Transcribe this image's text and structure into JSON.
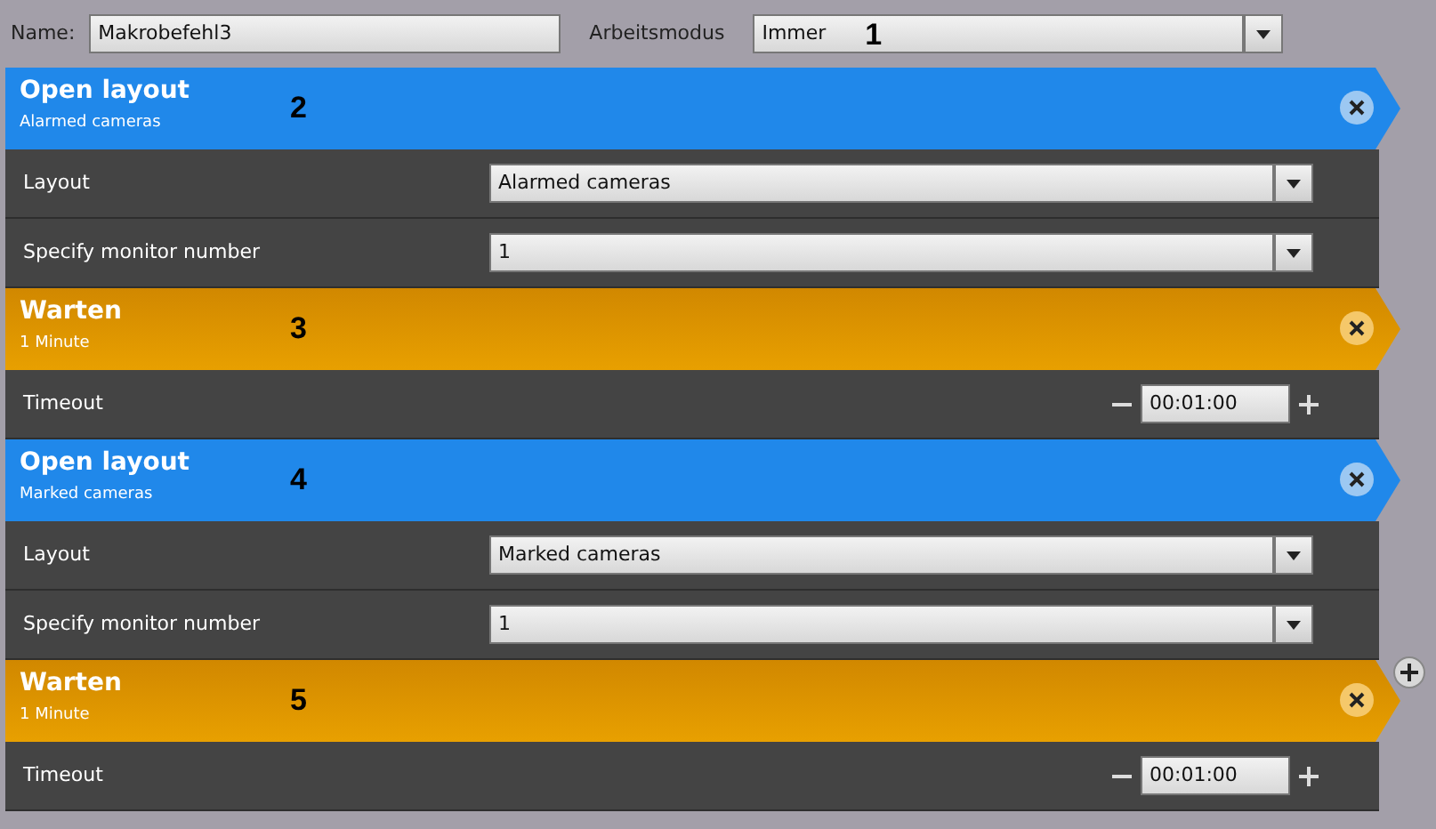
{
  "top_bar": {
    "name_label": "Name:",
    "name_value": "Makrobefehl3",
    "mode_label": "Arbeitsmodus",
    "mode_value": "Immer",
    "marker": "1"
  },
  "steps": [
    {
      "kind": "open_layout",
      "title": "Open layout",
      "subtitle": "Alarmed cameras",
      "marker": "2",
      "rows": [
        {
          "kind": "select",
          "label": "Layout",
          "value": "Alarmed cameras"
        },
        {
          "kind": "select",
          "label": "Specify monitor number",
          "value": "1"
        }
      ]
    },
    {
      "kind": "wait",
      "title": "Warten",
      "subtitle": "1 Minute",
      "marker": "3",
      "rows": [
        {
          "kind": "timeout",
          "label": "Timeout",
          "value": "00:01:00"
        }
      ]
    },
    {
      "kind": "open_layout",
      "title": "Open layout",
      "subtitle": "Marked cameras",
      "marker": "4",
      "rows": [
        {
          "kind": "select",
          "label": "Layout",
          "value": "Marked cameras"
        },
        {
          "kind": "select",
          "label": "Specify monitor number",
          "value": "1"
        }
      ]
    },
    {
      "kind": "wait",
      "title": "Warten",
      "subtitle": "1 Minute",
      "marker": "5",
      "add_button": true,
      "rows": [
        {
          "kind": "timeout",
          "label": "Timeout",
          "value": "00:01:00"
        }
      ]
    }
  ]
}
